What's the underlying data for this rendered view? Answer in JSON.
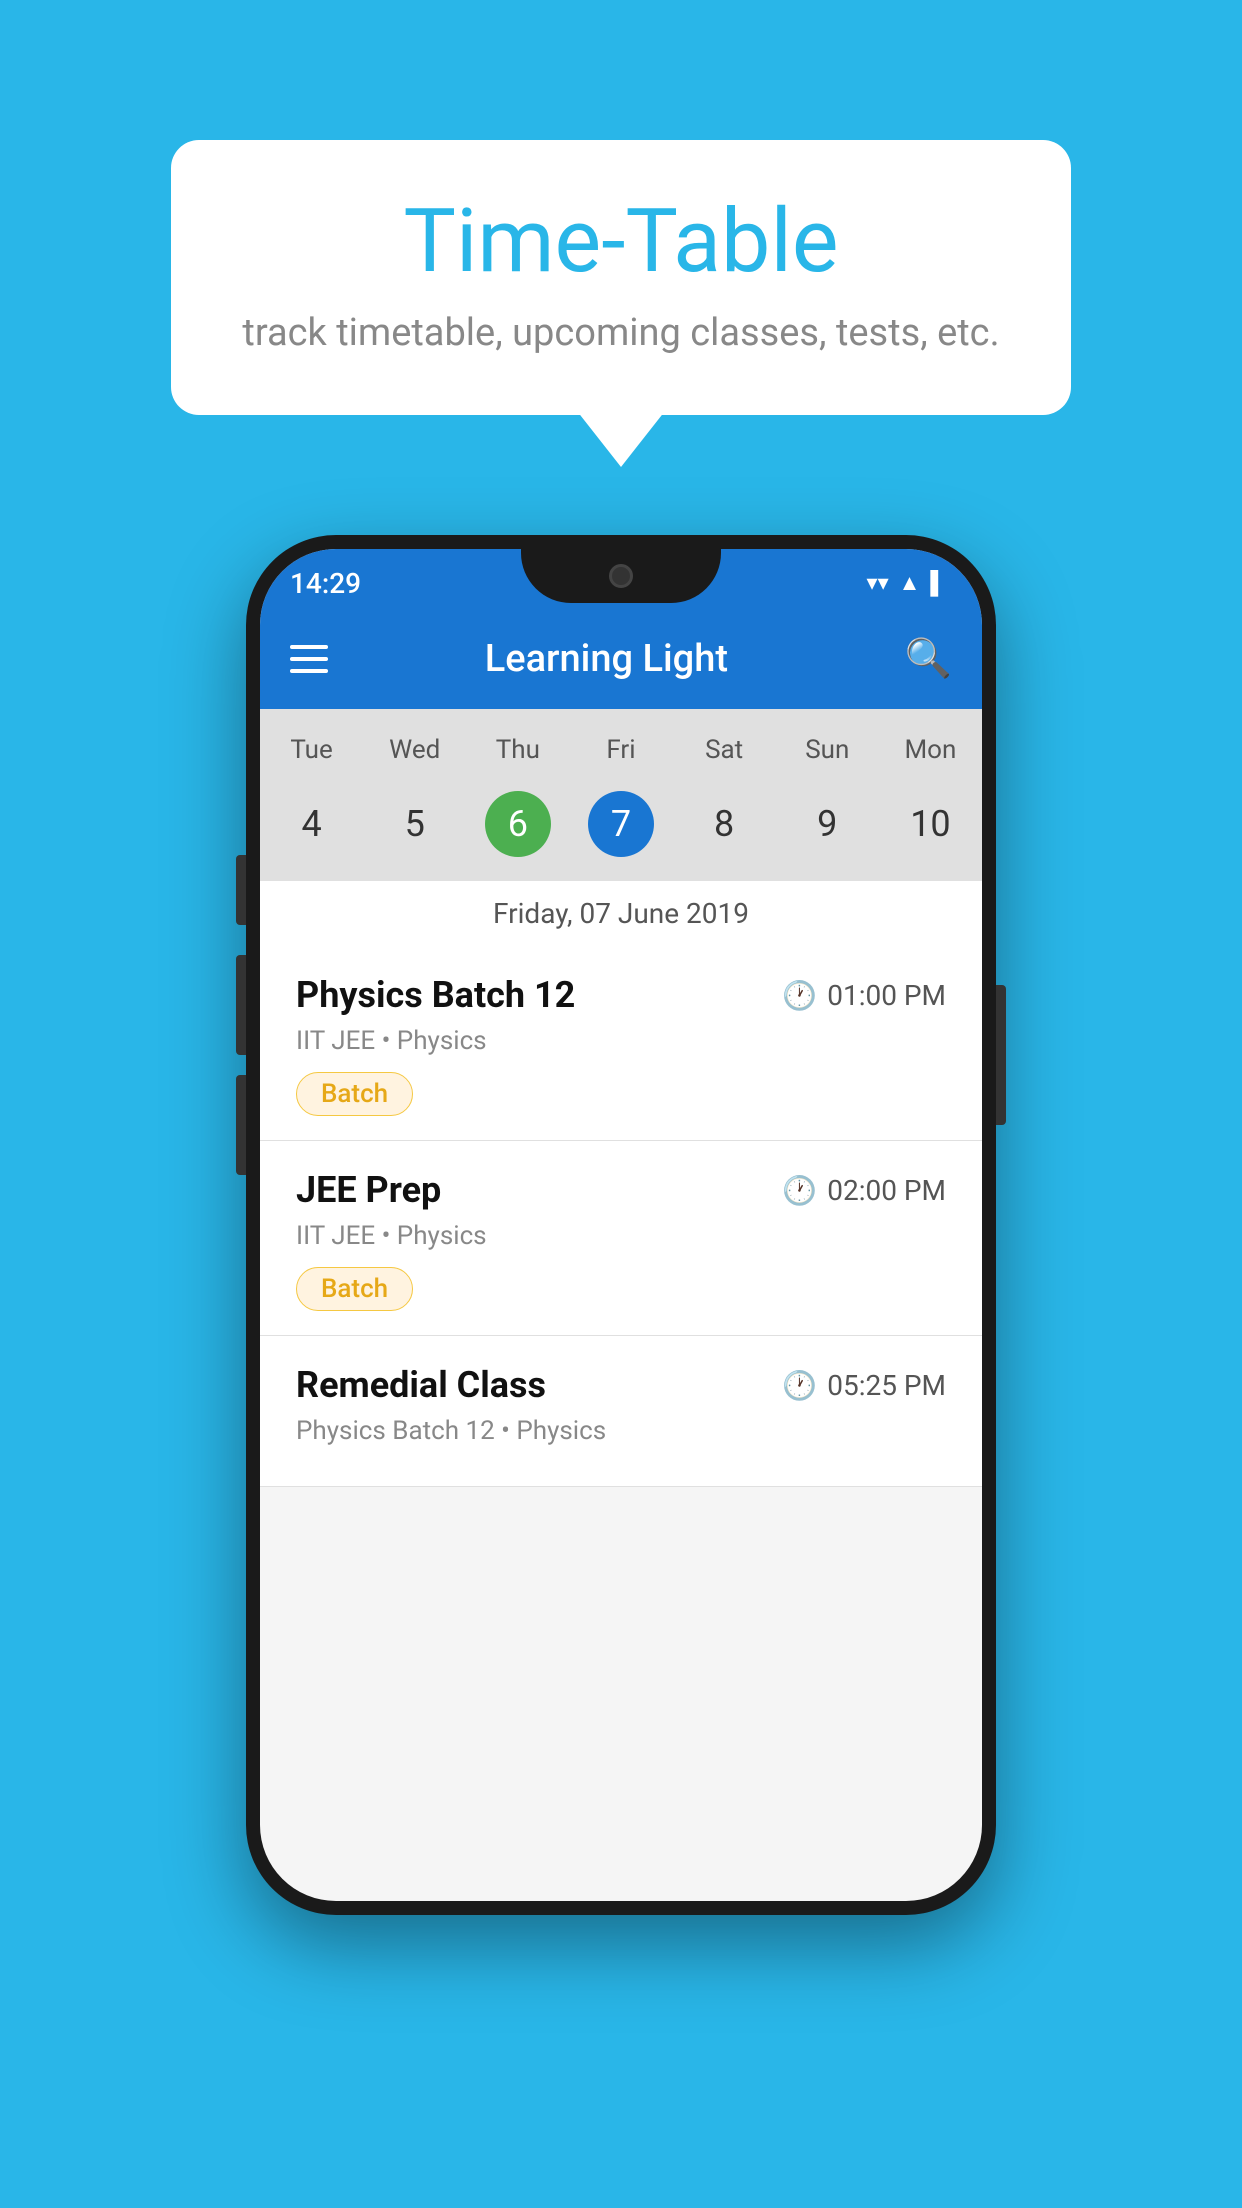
{
  "background_color": "#29b6e8",
  "bubble": {
    "title": "Time-Table",
    "subtitle": "track timetable, upcoming classes, tests, etc."
  },
  "phone": {
    "status_bar": {
      "time": "14:29",
      "icons": [
        "▼",
        "▲",
        "▌"
      ]
    },
    "app_bar": {
      "title": "Learning Light"
    },
    "calendar": {
      "days": [
        {
          "name": "Tue",
          "num": "4",
          "style": "normal"
        },
        {
          "name": "Wed",
          "num": "5",
          "style": "normal"
        },
        {
          "name": "Thu",
          "num": "6",
          "style": "today"
        },
        {
          "name": "Fri",
          "num": "7",
          "style": "selected"
        },
        {
          "name": "Sat",
          "num": "8",
          "style": "normal"
        },
        {
          "name": "Sun",
          "num": "9",
          "style": "normal"
        },
        {
          "name": "Mon",
          "num": "10",
          "style": "normal"
        }
      ],
      "selected_date": "Friday, 07 June 2019"
    },
    "schedule": [
      {
        "title": "Physics Batch 12",
        "time": "01:00 PM",
        "subtitle": "IIT JEE • Physics",
        "badge": "Batch"
      },
      {
        "title": "JEE Prep",
        "time": "02:00 PM",
        "subtitle": "IIT JEE • Physics",
        "badge": "Batch"
      },
      {
        "title": "Remedial Class",
        "time": "05:25 PM",
        "subtitle": "Physics Batch 12 • Physics",
        "badge": ""
      }
    ]
  }
}
